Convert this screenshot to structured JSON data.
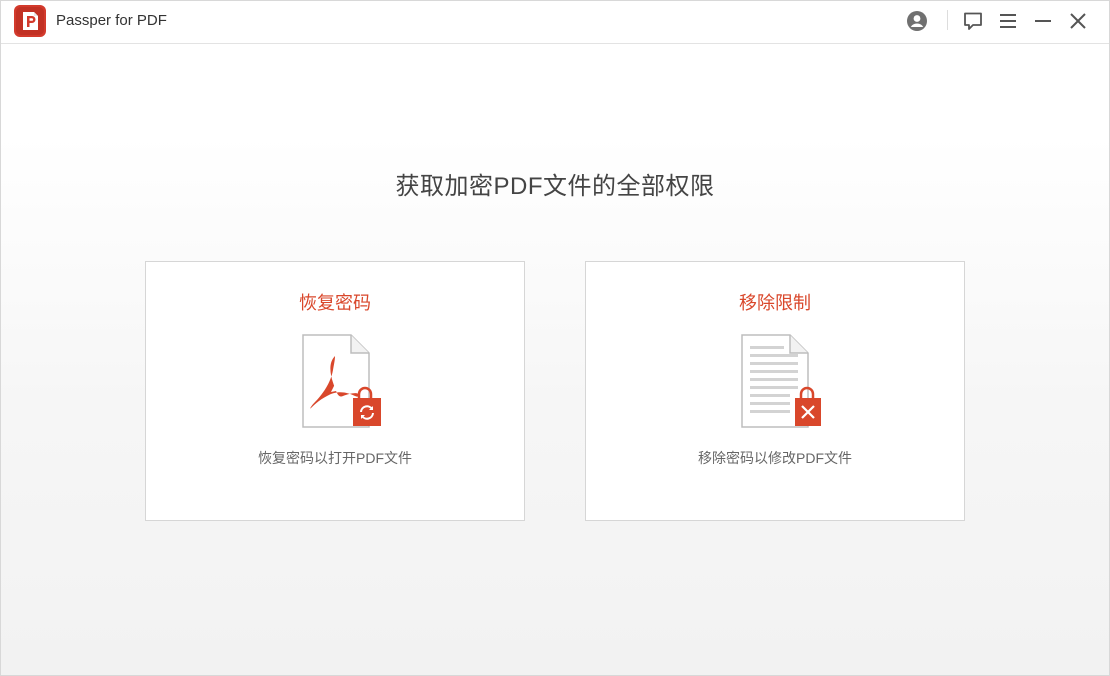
{
  "app": {
    "title": "Passper for PDF",
    "accent_color": "#d9472b"
  },
  "titlebar": {
    "buttons": [
      "account-icon",
      "feedback-icon",
      "menu-icon",
      "minimize-icon",
      "close-icon"
    ]
  },
  "main": {
    "headline": "获取加密PDF文件的全部权限",
    "cards": [
      {
        "title": "恢复密码",
        "description": "恢复密码以打开PDF文件",
        "icon": "pdf-lock-refresh-icon"
      },
      {
        "title": "移除限制",
        "description": "移除密码以修改PDF文件",
        "icon": "document-lock-remove-icon"
      }
    ]
  }
}
